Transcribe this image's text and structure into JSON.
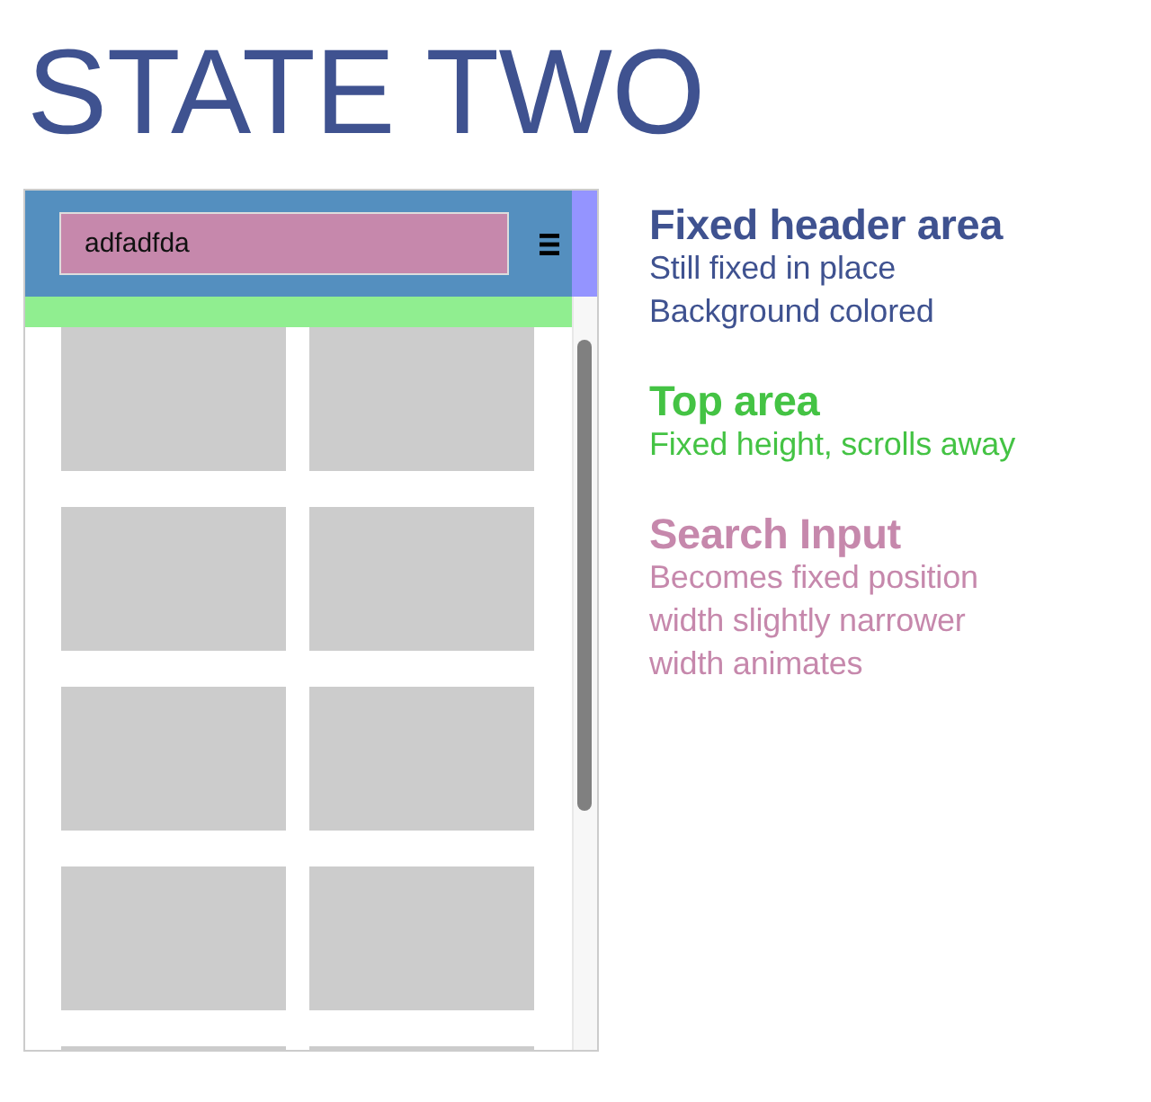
{
  "title": "STATE TWO",
  "phone": {
    "search": {
      "value": "adfadfda"
    }
  },
  "notes": [
    {
      "color": "#3f5290",
      "heading": "Fixed header area",
      "lines": [
        "Still fixed in place",
        "Background colored"
      ]
    },
    {
      "color": "#44c344",
      "heading": "Top area",
      "lines": [
        "Fixed height, scrolls away"
      ]
    },
    {
      "color": "#c688ac",
      "heading": "Search Input",
      "lines": [
        "Becomes fixed position",
        "width slightly narrower",
        "width animates"
      ]
    }
  ]
}
